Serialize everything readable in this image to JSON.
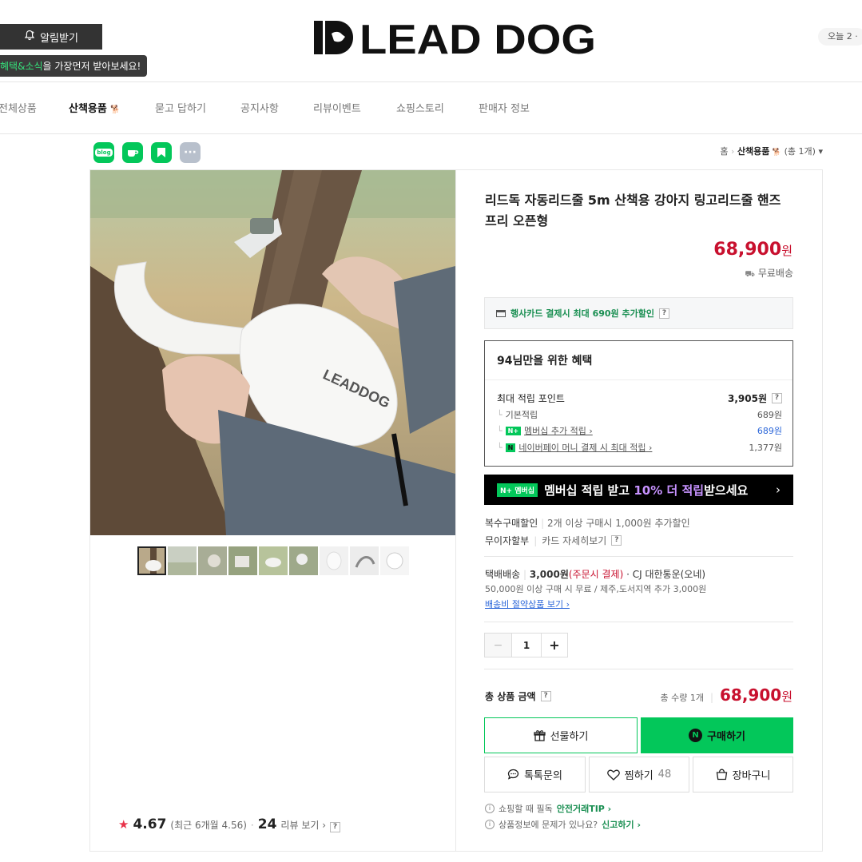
{
  "header": {
    "notify_label": "알림받기",
    "notify_tip_highlight": "혜택&소식",
    "notify_tip_rest": "을 가장먼저 받아보세요!",
    "logo_text": "LEAD DOG",
    "visitor": "오늘 2 ·"
  },
  "nav": {
    "items": [
      "전체상품",
      "산책용품",
      "묻고 답하기",
      "공지사항",
      "리뷰이벤트",
      "쇼핑스토리",
      "판매자 정보"
    ]
  },
  "share": {
    "blog": "blog"
  },
  "breadcrumb": {
    "home": "홈",
    "category": "산책용품",
    "count": "(총 1개)"
  },
  "product": {
    "title": "리드독 자동리드줄 5m 산책용 강아지 링고리드줄 핸즈프리 오픈형",
    "price": "68,900",
    "currency": "원",
    "shipping_badge": "무료배송",
    "card_discount": "행사카드 결제시 최대 690원 추가할인",
    "image_logo": "LEADDOG"
  },
  "benefit": {
    "heading": "94님만을 위한 혜택",
    "max_points_label": "최대 적립 포인트",
    "max_points_value": "3,905원",
    "rows": [
      {
        "label": "기본적립",
        "value": "689원"
      },
      {
        "label": "멤버십 추가 적립 ›",
        "value": "689원"
      },
      {
        "label": "네이버페이 머니 결제 시 최대 적립 ›",
        "value": "1,377원"
      }
    ]
  },
  "banner": {
    "badge": "멤버십",
    "pre": "멤버십 적립 받고",
    "highlight": "10% 더 적립",
    "post": "받으세요",
    "arrow": "›"
  },
  "details": {
    "multi_label": "복수구매할인",
    "multi_value": "2개 이상 구매시 1,000원 추가할인",
    "installment_label": "무이자할부",
    "installment_value": "카드 자세히보기",
    "delivery_label": "택배배송",
    "delivery_fee": "3,000원",
    "delivery_fee_note": "(주문시 결제)",
    "delivery_carrier": "· CJ 대한통운(오네)",
    "delivery_note": "50,000원 이상 구매 시 무료 / 제주,도서지역 추가 3,000원",
    "delivery_link": "배송비 절약상품 보기 ›"
  },
  "quantity": {
    "minus": "−",
    "value": "1",
    "plus": "+"
  },
  "total": {
    "label": "총 상품 금액",
    "count": "총 수량 1개",
    "amount": "68,900",
    "currency": "원"
  },
  "buttons": {
    "gift": "선물하기",
    "buy": "구매하기",
    "talk": "톡톡문의",
    "wish": "찜하기",
    "wish_count": "48",
    "cart": "장바구니"
  },
  "notes": {
    "safe_prefix": "쇼핑할 때 필독",
    "safe_link": "안전거래TIP ›",
    "report_prefix": "상품정보에 문제가 있나요?",
    "report_link": "신고하기 ›"
  },
  "rating": {
    "score": "4.67",
    "recent": "(최근 6개월 4.56)",
    "dot": "·",
    "reviews": "24",
    "reviews_link": "리뷰 보기 ›"
  },
  "colors": {
    "brand_green": "#03c75a",
    "price_red": "#c8102e",
    "membership_purple": "#c792ff"
  }
}
